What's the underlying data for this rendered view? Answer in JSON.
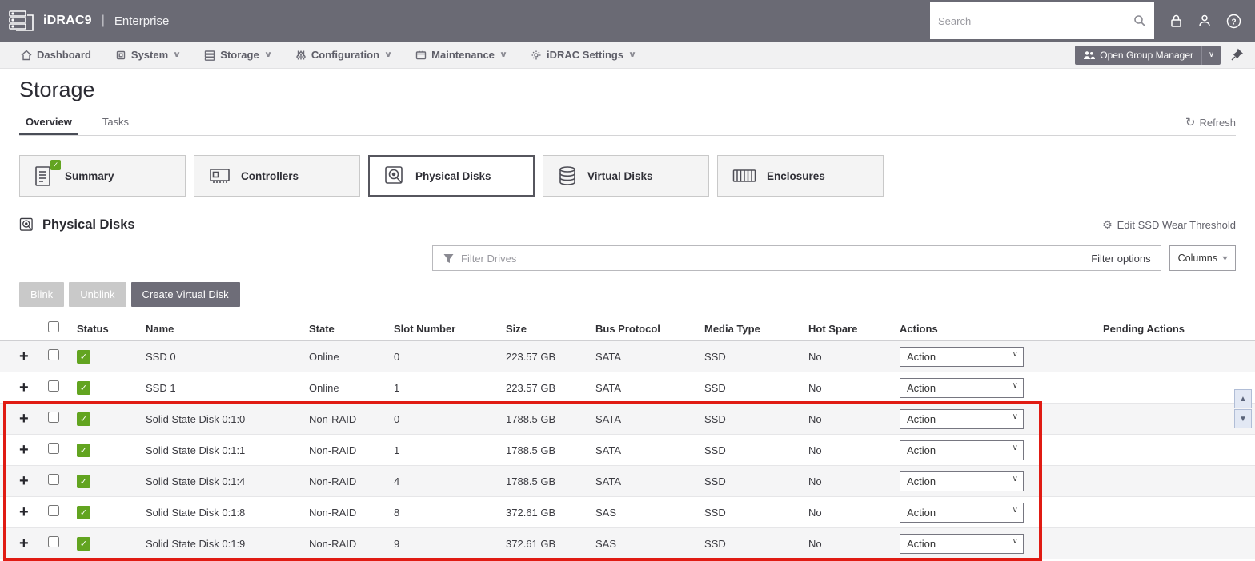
{
  "header": {
    "brand": "iDRAC9",
    "edition": "Enterprise",
    "search_placeholder": "Search"
  },
  "nav": {
    "items": [
      {
        "label": "Dashboard",
        "icon": "home-icon",
        "dropdown": false
      },
      {
        "label": "System",
        "icon": "system-icon",
        "dropdown": true
      },
      {
        "label": "Storage",
        "icon": "storage-icon",
        "dropdown": true
      },
      {
        "label": "Configuration",
        "icon": "configuration-icon",
        "dropdown": true
      },
      {
        "label": "Maintenance",
        "icon": "maintenance-icon",
        "dropdown": true
      },
      {
        "label": "iDRAC Settings",
        "icon": "idrac-settings-icon",
        "dropdown": true
      }
    ],
    "open_group_manager": "Open Group Manager"
  },
  "page": {
    "title": "Storage",
    "tabs": [
      {
        "label": "Overview",
        "active": true
      },
      {
        "label": "Tasks",
        "active": false
      }
    ],
    "refresh_label": "Refresh",
    "refresh_icon": "↻"
  },
  "cards": [
    {
      "label": "Summary",
      "icon": "summary-icon",
      "badge": "✓",
      "selected": false
    },
    {
      "label": "Controllers",
      "icon": "controllers-icon",
      "selected": false
    },
    {
      "label": "Physical Disks",
      "icon": "physical-disks-icon",
      "selected": true
    },
    {
      "label": "Virtual Disks",
      "icon": "virtual-disks-icon",
      "selected": false
    },
    {
      "label": "Enclosures",
      "icon": "enclosures-icon",
      "selected": false
    }
  ],
  "section": {
    "title": "Physical Disks",
    "edit_ssd_label": "Edit SSD Wear Threshold",
    "gear_glyph": "⚙"
  },
  "filter": {
    "placeholder": "Filter Drives",
    "options_label": "Filter options",
    "columns_label": "Columns"
  },
  "buttons": {
    "blink": "Blink",
    "unblink": "Unblink",
    "create_virtual_disk": "Create Virtual Disk"
  },
  "table": {
    "columns": [
      "Status",
      "Name",
      "State",
      "Slot Number",
      "Size",
      "Bus Protocol",
      "Media Type",
      "Hot Spare",
      "Actions",
      "Pending Actions"
    ],
    "action_label": "Action",
    "expand_icon": "+",
    "status_ok_icon": "✓",
    "rows": [
      {
        "name": "SSD 0",
        "state": "Online",
        "slot": "0",
        "size": "223.57 GB",
        "bus": "SATA",
        "media": "SSD",
        "hot_spare": "No"
      },
      {
        "name": "SSD 1",
        "state": "Online",
        "slot": "1",
        "size": "223.57 GB",
        "bus": "SATA",
        "media": "SSD",
        "hot_spare": "No"
      },
      {
        "name": "Solid State Disk 0:1:0",
        "state": "Non-RAID",
        "slot": "0",
        "size": "1788.5 GB",
        "bus": "SATA",
        "media": "SSD",
        "hot_spare": "No"
      },
      {
        "name": "Solid State Disk 0:1:1",
        "state": "Non-RAID",
        "slot": "1",
        "size": "1788.5 GB",
        "bus": "SATA",
        "media": "SSD",
        "hot_spare": "No"
      },
      {
        "name": "Solid State Disk 0:1:4",
        "state": "Non-RAID",
        "slot": "4",
        "size": "1788.5 GB",
        "bus": "SATA",
        "media": "SSD",
        "hot_spare": "No"
      },
      {
        "name": "Solid State Disk 0:1:8",
        "state": "Non-RAID",
        "slot": "8",
        "size": "372.61 GB",
        "bus": "SAS",
        "media": "SSD",
        "hot_spare": "No"
      },
      {
        "name": "Solid State Disk 0:1:9",
        "state": "Non-RAID",
        "slot": "9",
        "size": "372.61 GB",
        "bus": "SAS",
        "media": "SSD",
        "hot_spare": "No"
      }
    ],
    "highlight_rows_from": 2,
    "highlight_color": "#e01b13"
  }
}
